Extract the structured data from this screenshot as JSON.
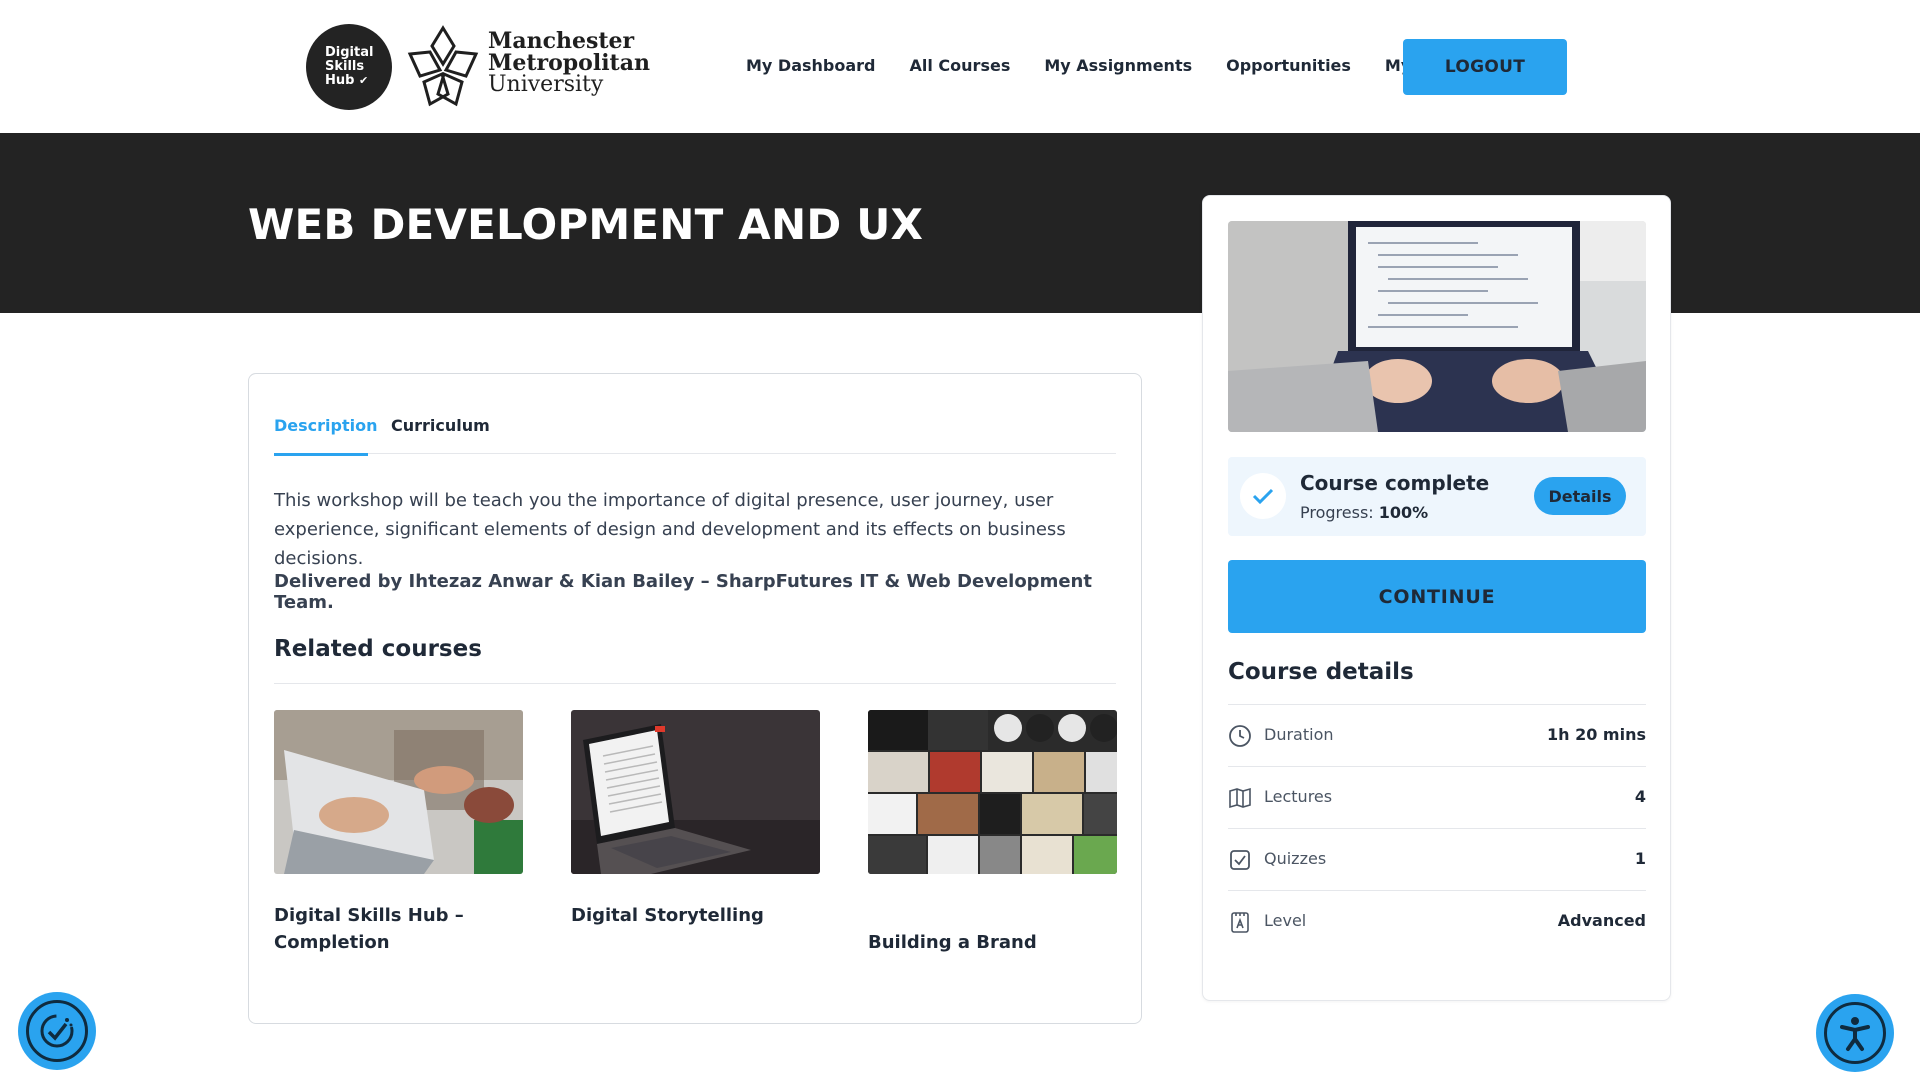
{
  "brand": {
    "hub_logo_lines": [
      "Digital",
      "Skills",
      "Hub"
    ],
    "university_line1": "Manchester",
    "university_line2": "Metropolitan",
    "university_line3": "University"
  },
  "nav": {
    "items": [
      "My Dashboard",
      "All Courses",
      "My Assignments",
      "Opportunities",
      "My Profile"
    ],
    "logout_label": "LOGOUT"
  },
  "page": {
    "title": "WEB DEVELOPMENT AND UX"
  },
  "tabs": [
    "Description",
    "Curriculum"
  ],
  "description": {
    "body": "This workshop will be teach you the importance of digital presence, user journey, user experience, significant elements of design and development and its effects on business decisions.",
    "delivered_by": "Delivered by Ihtezaz Anwar & Kian Bailey – SharpFutures IT & Web Development Team."
  },
  "related": {
    "title": "Related courses",
    "courses": [
      {
        "name": "Digital Skills Hub – Completion"
      },
      {
        "name": "Digital Storytelling"
      },
      {
        "name": "Building a Brand"
      }
    ]
  },
  "sidebar": {
    "status_title": "Course complete",
    "progress_label": "Progress:",
    "progress_value": "100%",
    "progress_fraction": 1.0,
    "details_label": "Details",
    "continue_label": "CONTINUE",
    "details_title": "Course details",
    "details": [
      {
        "icon": "clock-icon",
        "label": "Duration",
        "value": "1h 20 mins"
      },
      {
        "icon": "book-icon",
        "label": "Lectures",
        "value": "4"
      },
      {
        "icon": "checkbox-icon",
        "label": "Quizzes",
        "value": "1"
      },
      {
        "icon": "level-icon",
        "label": "Level",
        "value": "Advanced"
      }
    ]
  },
  "colors": {
    "accent": "#2aa3ef",
    "banner": "#232323",
    "status_bg": "#eef6fd"
  }
}
